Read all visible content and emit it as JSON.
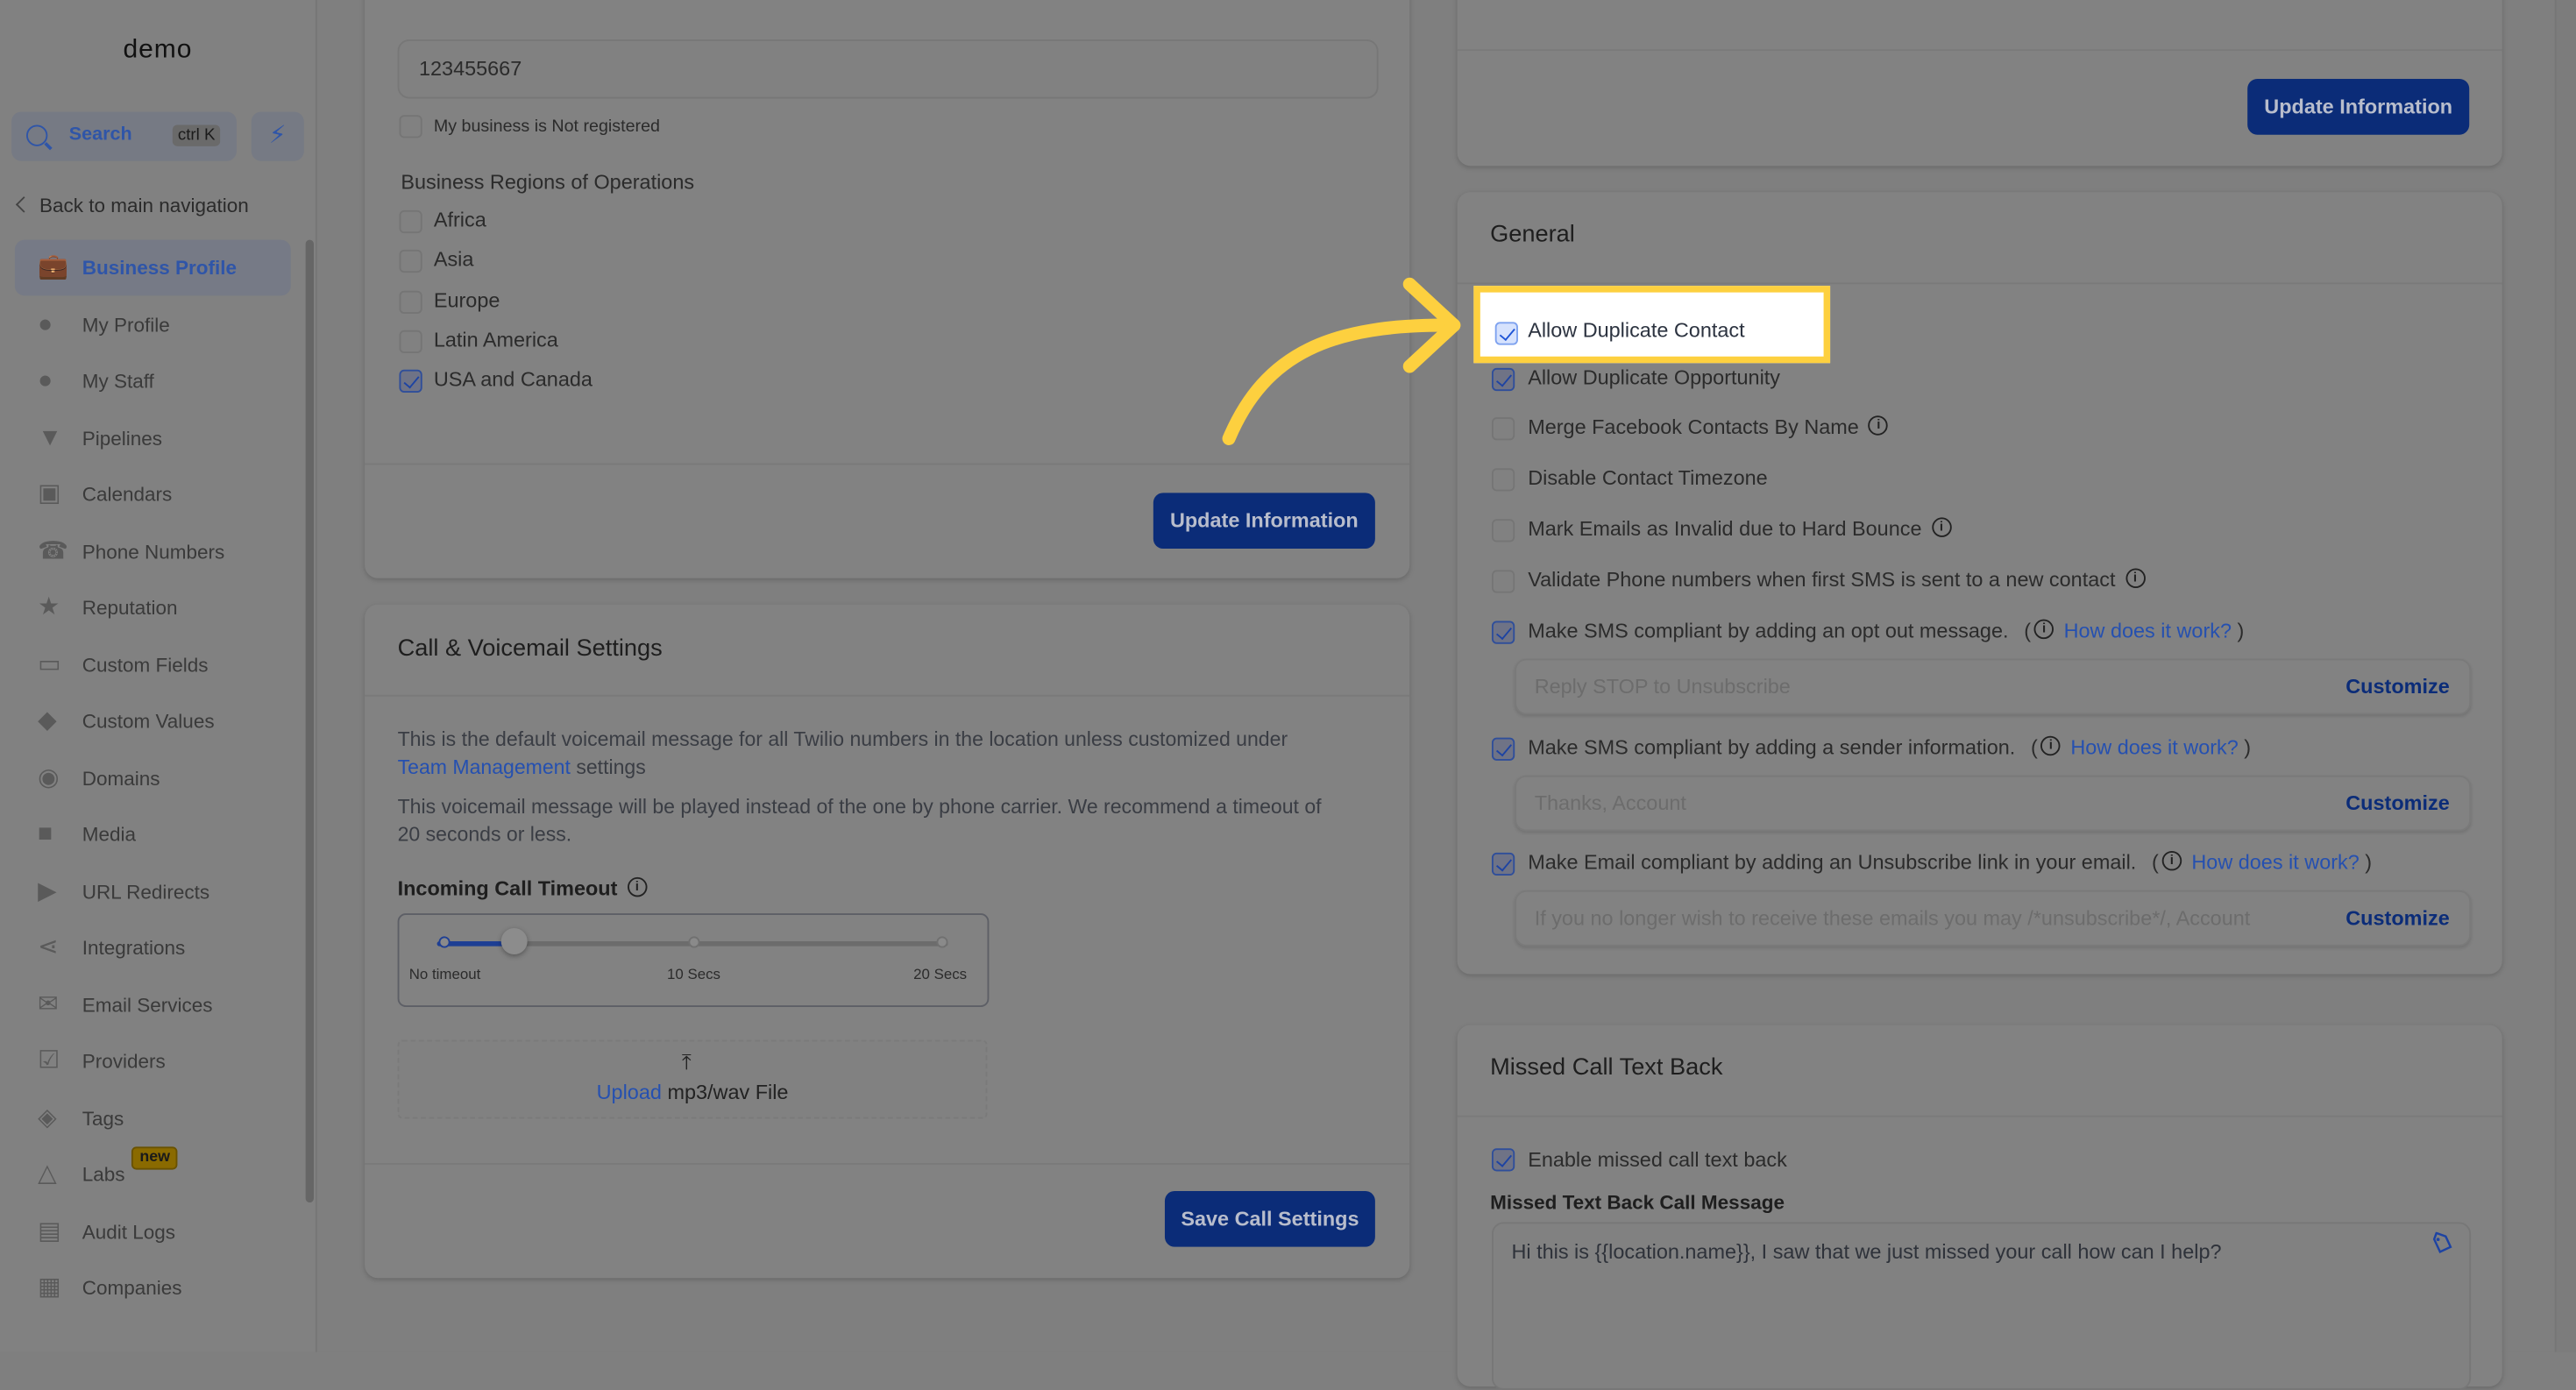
{
  "app": {
    "logo": "demo"
  },
  "sidebar": {
    "search": {
      "label": "Search",
      "shortcut": "ctrl K"
    },
    "quick_action_icon": "bolt-icon",
    "back_label": "Back to main navigation",
    "items": [
      {
        "label": "Business Profile",
        "icon": "briefcase-icon",
        "active": true
      },
      {
        "label": "My Profile",
        "icon": "user-circle-icon"
      },
      {
        "label": "My Staff",
        "icon": "user-icon"
      },
      {
        "label": "Pipelines",
        "icon": "funnel-icon"
      },
      {
        "label": "Calendars",
        "icon": "calendar-icon"
      },
      {
        "label": "Phone Numbers",
        "icon": "phone-icon"
      },
      {
        "label": "Reputation",
        "icon": "star-icon"
      },
      {
        "label": "Custom Fields",
        "icon": "text-field-icon"
      },
      {
        "label": "Custom Values",
        "icon": "gem-icon"
      },
      {
        "label": "Domains",
        "icon": "globe-icon"
      },
      {
        "label": "Media",
        "icon": "video-icon"
      },
      {
        "label": "URL Redirects",
        "icon": "cursor-icon"
      },
      {
        "label": "Integrations",
        "icon": "git-branch-icon"
      },
      {
        "label": "Email Services",
        "icon": "mail-icon"
      },
      {
        "label": "Providers",
        "icon": "clipboard-check-icon"
      },
      {
        "label": "Tags",
        "icon": "tag-icon"
      },
      {
        "label": "Labs",
        "icon": "flask-icon",
        "badge": "new"
      },
      {
        "label": "Audit Logs",
        "icon": "bar-chart-icon"
      },
      {
        "label": "Companies",
        "icon": "building-icon"
      }
    ]
  },
  "business_info": {
    "registration_value": "123455667",
    "not_registered_label": "My business is Not registered",
    "not_registered_checked": false,
    "regions_title": "Business Regions of Operations",
    "regions": [
      {
        "label": "Africa",
        "checked": false
      },
      {
        "label": "Asia",
        "checked": false
      },
      {
        "label": "Europe",
        "checked": false
      },
      {
        "label": "Latin America",
        "checked": false
      },
      {
        "label": "USA and Canada",
        "checked": true
      }
    ],
    "update_button": "Update Information"
  },
  "call_settings": {
    "title": "Call & Voicemail Settings",
    "desc1_prefix": "This is the default voicemail message for all Twilio numbers in the location unless customized under",
    "desc1_link": "Team Management",
    "desc1_suffix": "settings",
    "desc2_line1": "This voicemail message will be played instead of the one by phone carrier. We recommend a timeout of",
    "desc2_line2": "20 seconds or less.",
    "timeout_label": "Incoming Call Timeout",
    "timeout_value_secs": 3,
    "timeout_max_secs": 20,
    "slider_labels": [
      "No timeout",
      "10 Secs",
      "20 Secs"
    ],
    "upload_link": "Upload",
    "upload_text": "mp3/wav File",
    "save_button": "Save Call Settings"
  },
  "right_top": {
    "update_button": "Update Information"
  },
  "general": {
    "title": "General",
    "options": [
      {
        "label": "Allow Duplicate Contact",
        "checked": true,
        "highlighted": true
      },
      {
        "label": "Allow Duplicate Opportunity",
        "checked": true
      },
      {
        "label": "Merge Facebook Contacts By Name",
        "checked": false,
        "info": true
      },
      {
        "label": "Disable Contact Timezone",
        "checked": false
      },
      {
        "label": "Mark Emails as Invalid due to Hard Bounce",
        "checked": false,
        "info": true
      },
      {
        "label": "Validate Phone numbers when first SMS is sent to a new contact",
        "checked": false,
        "info": true
      },
      {
        "label": "Make SMS compliant by adding an opt out message.",
        "checked": true,
        "help_link": "How does it work?",
        "field_placeholder": "Reply STOP to Unsubscribe",
        "field_action": "Customize"
      },
      {
        "label": "Make SMS compliant by adding a sender information.",
        "checked": true,
        "help_link": "How does it work?",
        "field_placeholder": "Thanks, Account",
        "field_action": "Customize"
      },
      {
        "label": "Make Email compliant by adding an Unsubscribe link in your email.",
        "checked": true,
        "help_link": "How does it work?",
        "field_placeholder": "If you no longer wish to receive these emails you may /*unsubscribe*/, Account",
        "field_action": "Customize"
      }
    ]
  },
  "missed_call": {
    "title": "Missed Call Text Back",
    "enable_label": "Enable missed call text back",
    "enable_checked": true,
    "message_label": "Missed Text Back Call Message",
    "message_value": "Hi this is {{location.name}}, I saw that we just missed your call how can I help?"
  },
  "annotation": {
    "highlight_color": "#fdd03f",
    "target": "Allow Duplicate Contact"
  },
  "colors": {
    "primary_button": "#0b2c78",
    "link": "#2550b0",
    "overlay_bg": "#7f7f7f"
  }
}
